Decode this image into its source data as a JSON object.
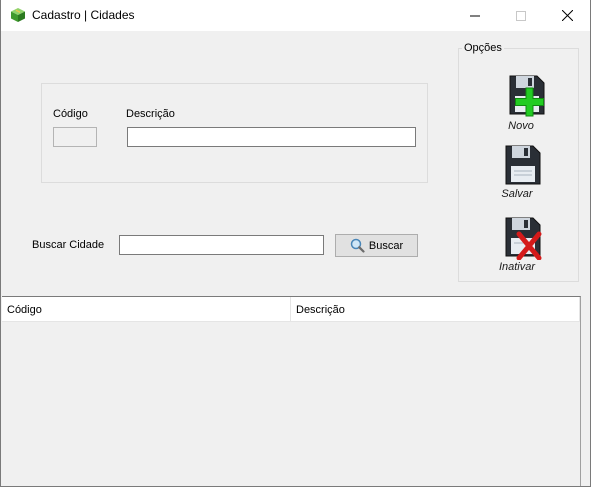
{
  "window": {
    "title": "Cadastro | Cidades",
    "app_icon": "green-cube-icon",
    "controls": {
      "minimize": "minimize-icon",
      "maximize": "maximize-icon",
      "close": "close-icon"
    }
  },
  "form": {
    "codigo_label": "Código",
    "codigo_value": "",
    "descricao_label": "Descrição",
    "descricao_value": ""
  },
  "search": {
    "label": "Buscar Cidade",
    "value": "",
    "button_label": "Buscar",
    "button_icon": "magnifier-icon"
  },
  "options": {
    "title": "Opções",
    "buttons": [
      {
        "label": "Novo",
        "icon": "floppy-plus-icon"
      },
      {
        "label": "Salvar",
        "icon": "floppy-icon"
      },
      {
        "label": "Inativar",
        "icon": "floppy-x-icon"
      }
    ]
  },
  "grid": {
    "columns": [
      "Código",
      "Descrição"
    ],
    "rows": []
  },
  "colors": {
    "window_bg": "#f0f0f0",
    "plus_green": "#22cc22",
    "x_red": "#d41a1a"
  }
}
